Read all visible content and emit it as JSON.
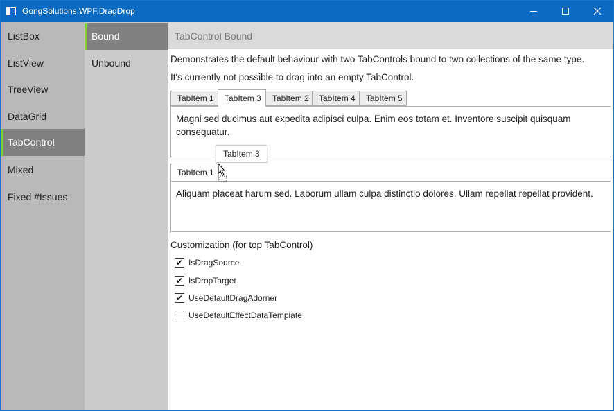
{
  "window": {
    "title": "GongSolutions.WPF.DragDrop",
    "accent": "#0b6bc2",
    "nav_accent": "#7dd330"
  },
  "nav_primary": {
    "items": [
      {
        "label": "ListBox"
      },
      {
        "label": "ListView"
      },
      {
        "label": "TreeView"
      },
      {
        "label": "DataGrid"
      },
      {
        "label": "TabControl"
      },
      {
        "label": "Mixed"
      },
      {
        "label": "Fixed #Issues"
      }
    ],
    "selected": "TabControl"
  },
  "nav_secondary": {
    "items": [
      {
        "label": "Bound"
      },
      {
        "label": "Unbound"
      }
    ],
    "selected": "Bound"
  },
  "content": {
    "header_title": "TabControl Bound",
    "description_1": "Demonstrates the default behaviour with two TabControls bound to two collections of the same type.",
    "description_2": "It's currently not possible to drag into an empty TabControl.",
    "top_tabs": {
      "tabs": [
        {
          "label": "TabItem 1"
        },
        {
          "label": "TabItem 3"
        },
        {
          "label": "TabItem 2"
        },
        {
          "label": "TabItem 4"
        },
        {
          "label": "TabItem 5"
        }
      ],
      "selected": "TabItem 3",
      "panel_text": "Magni sed ducimus aut expedita adipisci culpa. Enim eos totam et. Inventore suscipit quisquam consequatur."
    },
    "bottom_tabs": {
      "tabs": [
        {
          "label": "TabItem 1"
        }
      ],
      "selected": "TabItem 1",
      "panel_text": "Aliquam placeat harum sed. Laborum ullam culpa distinctio dolores. Ullam repellat repellat provident."
    },
    "drag_adorner_label": "TabItem 3",
    "customization": {
      "title": "Customization (for top TabControl)",
      "options": [
        {
          "label": "IsDragSource",
          "checked": true
        },
        {
          "label": "IsDropTarget",
          "checked": true
        },
        {
          "label": "UseDefaultDragAdorner",
          "checked": true
        },
        {
          "label": "UseDefaultEffectDataTemplate",
          "checked": false
        }
      ]
    }
  },
  "icons": {
    "app": "app-window-icon",
    "minimize": "minimize-icon",
    "maximize": "maximize-icon",
    "close": "close-icon",
    "cursor": "drag-cursor-icon",
    "check": "✔"
  }
}
